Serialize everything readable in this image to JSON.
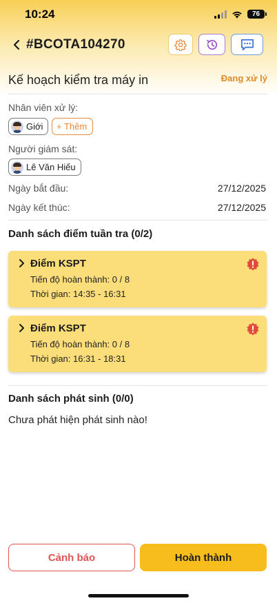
{
  "status_bar": {
    "time": "10:24",
    "battery": "76"
  },
  "header": {
    "title": "#BCOTA104270",
    "icons": [
      "back-chevron-icon",
      "settings-gear-icon",
      "history-icon",
      "chat-icon"
    ]
  },
  "plan": {
    "title": "Kế hoạch kiểm tra máy in",
    "status": "Đang xử lý"
  },
  "staff": {
    "label": "Nhân viên xử lý:",
    "members": [
      "Giới"
    ],
    "add_label": "+ Thêm"
  },
  "supervisor": {
    "label": "Người giám sát:",
    "name": "Lê Văn Hiếu"
  },
  "dates": {
    "start_label": "Ngày bắt đầu:",
    "start_value": "27/12/2025",
    "end_label": "Ngày kết thúc:",
    "end_value": "27/12/2025"
  },
  "checkpoints": {
    "title": "Danh sách điểm tuần tra (0/2)",
    "items": [
      {
        "name": "Điểm KSPT",
        "progress": "Tiến độ hoàn thành: 0 / 8",
        "time": "Thời gian: 14:35 - 16:31"
      },
      {
        "name": "Điểm KSPT",
        "progress": "Tiến độ hoàn thành: 0 / 8",
        "time": "Thời gian: 16:31 - 18:31"
      }
    ]
  },
  "incidents": {
    "title": "Danh sách phát sinh (0/0)",
    "empty_text": "Chưa phát hiện phát sinh nào!"
  },
  "actions": {
    "warn_label": "Cảnh báo",
    "done_label": "Hoàn thành"
  },
  "colors": {
    "accent": "#f7bd1d",
    "status_orange": "#e08a2a",
    "warning_red": "#e25454",
    "card_bg": "#fbdd7a"
  }
}
